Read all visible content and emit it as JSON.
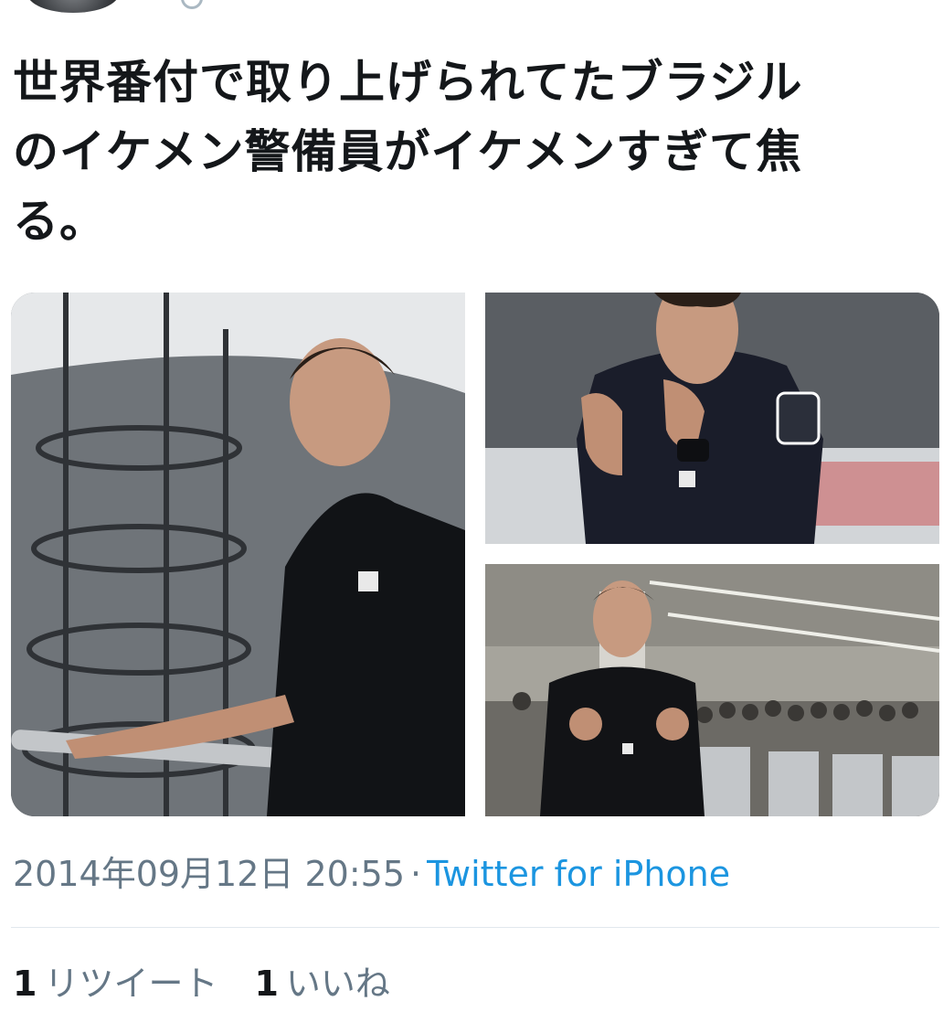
{
  "tweet": {
    "text_line1": "世界番付で取り上げられてたブラジル",
    "text_line2": "のイケメン警備員がイケメンすぎて焦",
    "text_line3": "る。"
  },
  "media": {
    "photos": [
      {
        "alt": "photo-security-guard-stairs"
      },
      {
        "alt": "photo-security-guard-closeup"
      },
      {
        "alt": "photo-security-guard-station"
      }
    ]
  },
  "meta": {
    "timestamp": "2014年09月12日 20:55",
    "separator": "·",
    "source": "Twitter for iPhone"
  },
  "stats": {
    "retweet_count": "1",
    "retweet_label": "リツイート",
    "like_count": "1",
    "like_label": "いいね"
  },
  "colors": {
    "text": "#14171a",
    "secondary": "#657786",
    "link": "#1b95e0",
    "divider": "#e1e8ed"
  }
}
